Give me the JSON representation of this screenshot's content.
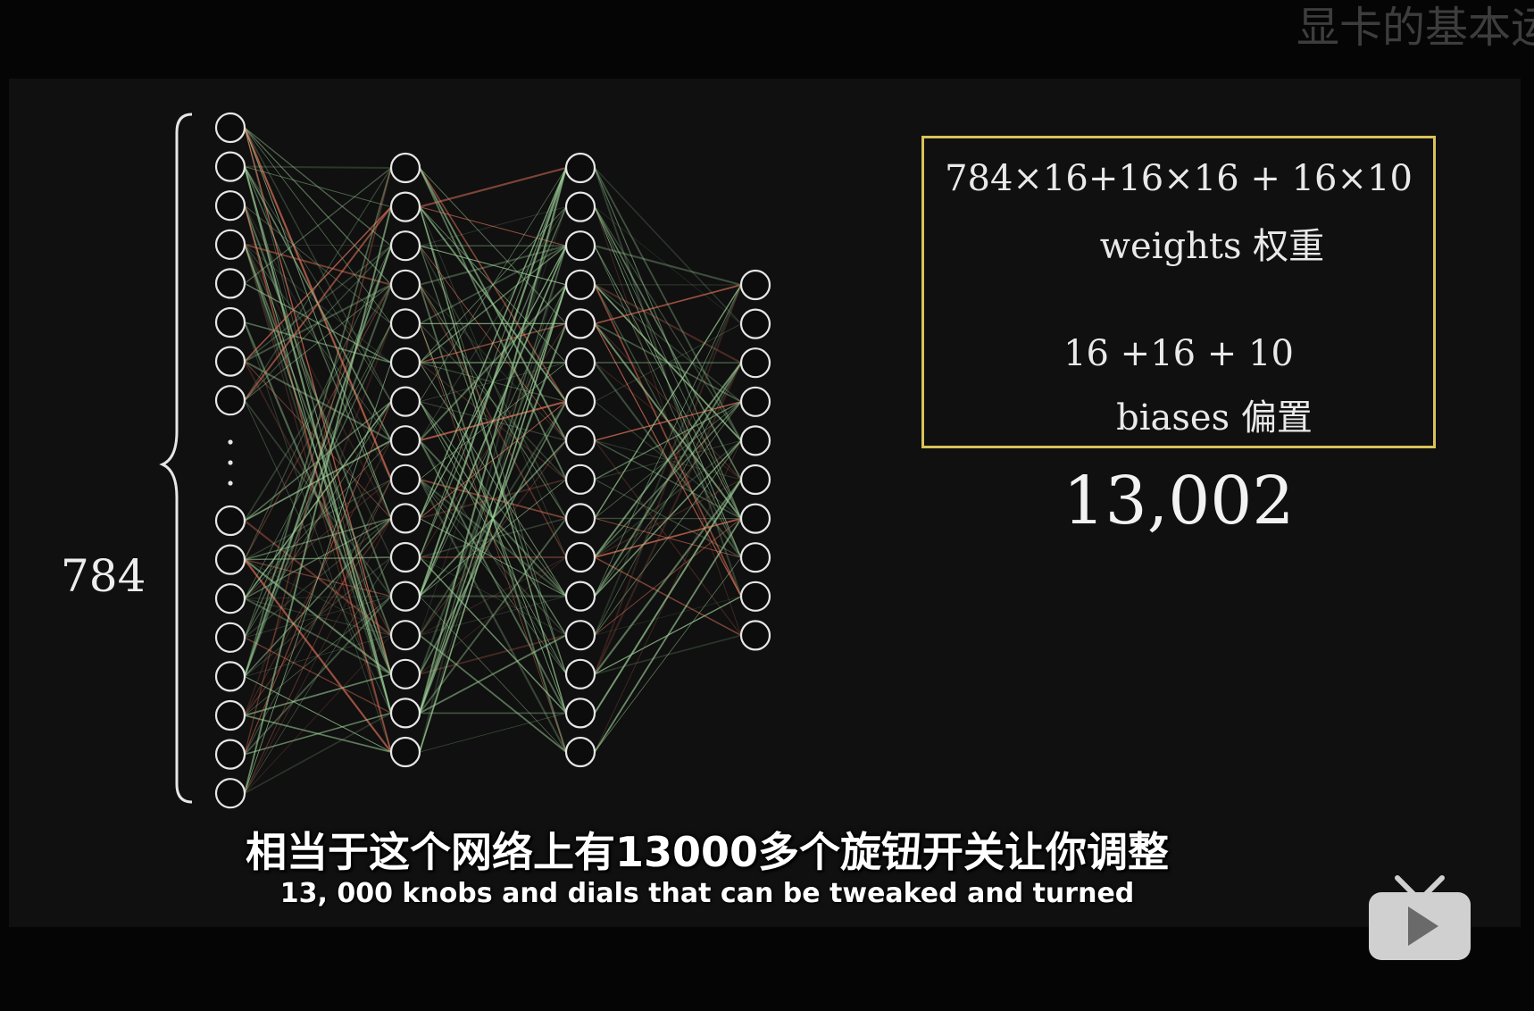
{
  "watermark": {
    "text": "显卡的基本运"
  },
  "video": {
    "network": {
      "layers": [
        16,
        16,
        16,
        10
      ],
      "input_label": "784",
      "colors": {
        "node": "#e6e6e6",
        "positive": "#9fd39a",
        "negative": "#e0735a"
      }
    },
    "param_box": {
      "weights_expr": "784×16+16×16 + 16×10",
      "weights_label": "weights 权重",
      "biases_expr": "16 +16 + 10",
      "biases_label": "biases 偏置",
      "border_color": "#d8c35a"
    },
    "total": "13,002",
    "subtitle_zh": "相当于这个网络上有13000多个旋钮开关让你调整",
    "subtitle_en": "13, 000 knobs and dials that can be tweaked and turned"
  },
  "tv_button": {
    "icon": "play-tv-icon"
  }
}
